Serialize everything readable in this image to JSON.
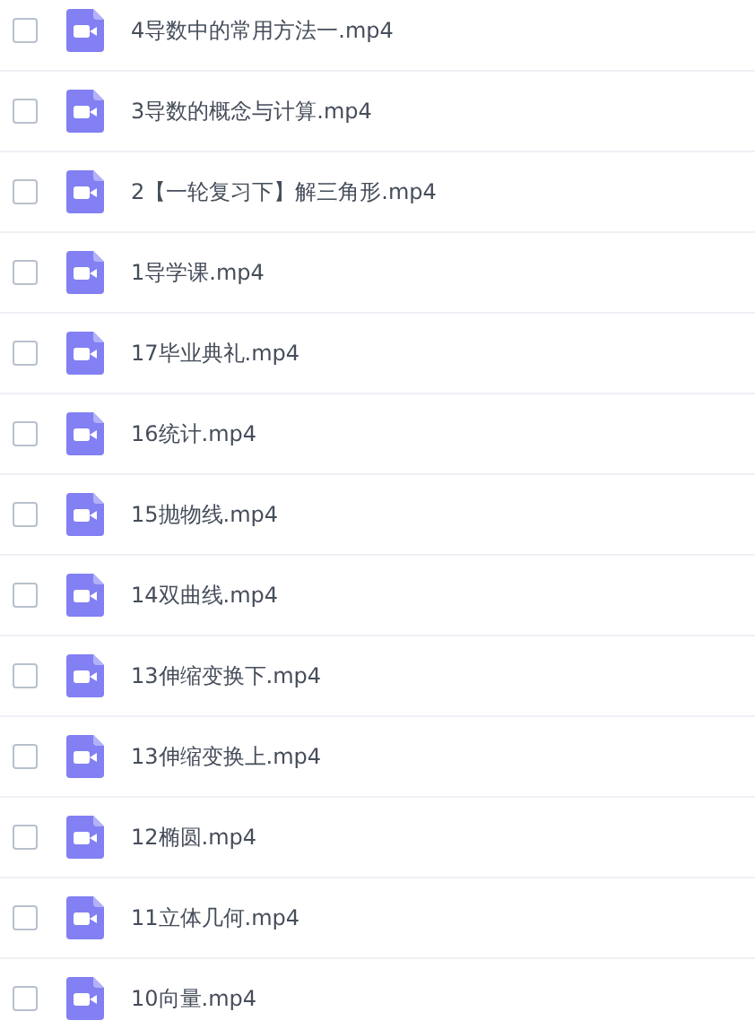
{
  "files": [
    {
      "name": "4导数中的常用方法一.mp4",
      "checked": false
    },
    {
      "name": "3导数的概念与计算.mp4",
      "checked": false
    },
    {
      "name": "2【一轮复习下】解三角形.mp4",
      "checked": false
    },
    {
      "name": "1导学课.mp4",
      "checked": false
    },
    {
      "name": "17毕业典礼.mp4",
      "checked": false
    },
    {
      "name": "16统计.mp4",
      "checked": false
    },
    {
      "name": "15抛物线.mp4",
      "checked": false
    },
    {
      "name": "14双曲线.mp4",
      "checked": false
    },
    {
      "name": "13伸缩变换下.mp4",
      "checked": false
    },
    {
      "name": "13伸缩变换上.mp4",
      "checked": false
    },
    {
      "name": "12椭圆.mp4",
      "checked": false
    },
    {
      "name": "11立体几何.mp4",
      "checked": false
    },
    {
      "name": "10向量.mp4",
      "checked": false
    }
  ]
}
